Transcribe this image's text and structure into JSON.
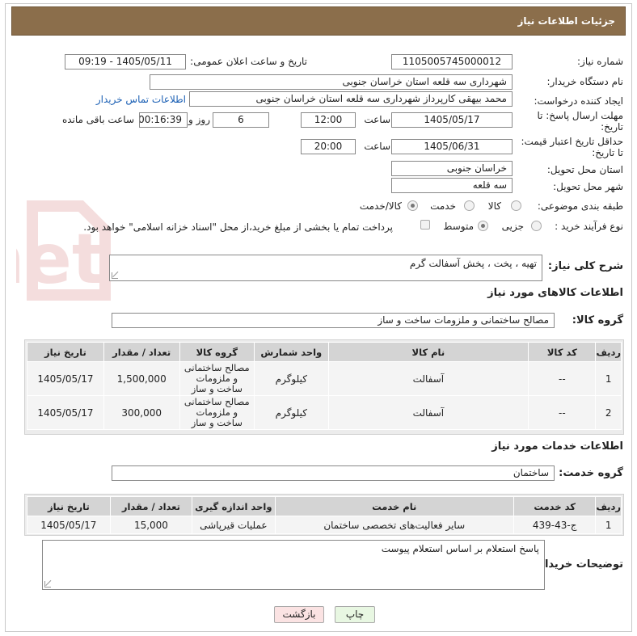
{
  "header": {
    "title": "جزئیات اطلاعات نیاز"
  },
  "fields": {
    "need_number_label": "شماره نیاز:",
    "need_number": "1105005745000012",
    "announce_label": "تاریخ و ساعت اعلان عمومی:",
    "announce_value": "1405/05/11 - 09:19",
    "buyer_org_label": "نام دستگاه خریدار:",
    "buyer_org": "شهرداری سه قلعه استان خراسان جنوبی",
    "creator_label": "ایجاد کننده درخواست:",
    "creator": "محمد بیهقی کارپرداز شهرداری سه قلعه استان خراسان جنوبی",
    "contact_link": "اطلاعات تماس خریدار",
    "deadline_label_1": "مهلت ارسال پاسخ: تا",
    "deadline_label_2": "تاریخ:",
    "deadline_date": "1405/05/17",
    "time_label": "ساعت",
    "deadline_time": "12:00",
    "days_value": "6",
    "days_label": "روز و",
    "remaining_time": "00:16:39",
    "remaining_label": "ساعت باقی مانده",
    "price_label_1": "حداقل تاریخ اعتبار قیمت:",
    "price_label_2": "تا تاریخ:",
    "price_date": "1405/06/31",
    "price_time": "20:00",
    "province_label": "استان محل تحویل:",
    "province": "خراسان جنوبی",
    "city_label": "شهر محل تحویل:",
    "city": "سه قلعه",
    "category_label": "طبقه بندی موضوعی:",
    "cat_goods": "کالا",
    "cat_service": "خدمت",
    "cat_goods_service": "کالا/خدمت",
    "process_label": "نوع فرآیند خرید :",
    "proc_minor": "جزیی",
    "proc_medium": "متوسط",
    "payment_note": "پرداخت تمام یا بخشی از مبلغ خرید،از محل \"اسناد خزانه اسلامی\" خواهد بود."
  },
  "description": {
    "label": "شرح کلی نیاز:",
    "value": "تهیه ، پخت ، پخش آسفالت گرم"
  },
  "goods": {
    "section_title": "اطلاعات کالاهای مورد نیاز",
    "group_label": "گروه کالا:",
    "group_value": "مصالح ساختمانی و ملزومات ساخت و ساز",
    "columns": [
      "ردیف",
      "کد کالا",
      "نام کالا",
      "واحد شمارش",
      "گروه کالا",
      "تعداد / مقدار",
      "تاریخ نیاز"
    ],
    "rows": [
      {
        "idx": "1",
        "code": "--",
        "name": "آسفالت",
        "unit": "کیلوگرم",
        "group": "مصالح ساختمانی و ملزومات ساخت و ساز",
        "qty": "1,500,000",
        "date": "1405/05/17"
      },
      {
        "idx": "2",
        "code": "--",
        "name": "آسفالت",
        "unit": "کیلوگرم",
        "group": "مصالح ساختمانی و ملزومات ساخت و ساز",
        "qty": "300,000",
        "date": "1405/05/17"
      }
    ]
  },
  "services": {
    "section_title": "اطلاعات خدمات مورد نیاز",
    "group_label": "گروه خدمت:",
    "group_value": "ساختمان",
    "columns": [
      "ردیف",
      "کد خدمت",
      "نام خدمت",
      "واحد اندازه گیری",
      "تعداد / مقدار",
      "تاریخ نیاز"
    ],
    "rows": [
      {
        "idx": "1",
        "code": "ج-43-439",
        "name": "سایر فعالیت‌های تخصصی ساختمان",
        "unit": "عملیات قیرپاشی",
        "qty": "15,000",
        "date": "1405/05/17"
      }
    ]
  },
  "buyer_notes": {
    "label": "توضیحات خریدار:",
    "value": "پاسخ استعلام بر اساس استعلام پیوست"
  },
  "buttons": {
    "print": "چاپ",
    "back": "بازگشت"
  },
  "watermark": {
    "text": "AriaTender.net"
  },
  "colors": {
    "header_bg": "#8b6e4b",
    "link": "#1a5fb4",
    "table_header": "#d4d4d4",
    "print_btn": "#e8f7e2",
    "back_btn": "#fbe3e3"
  }
}
